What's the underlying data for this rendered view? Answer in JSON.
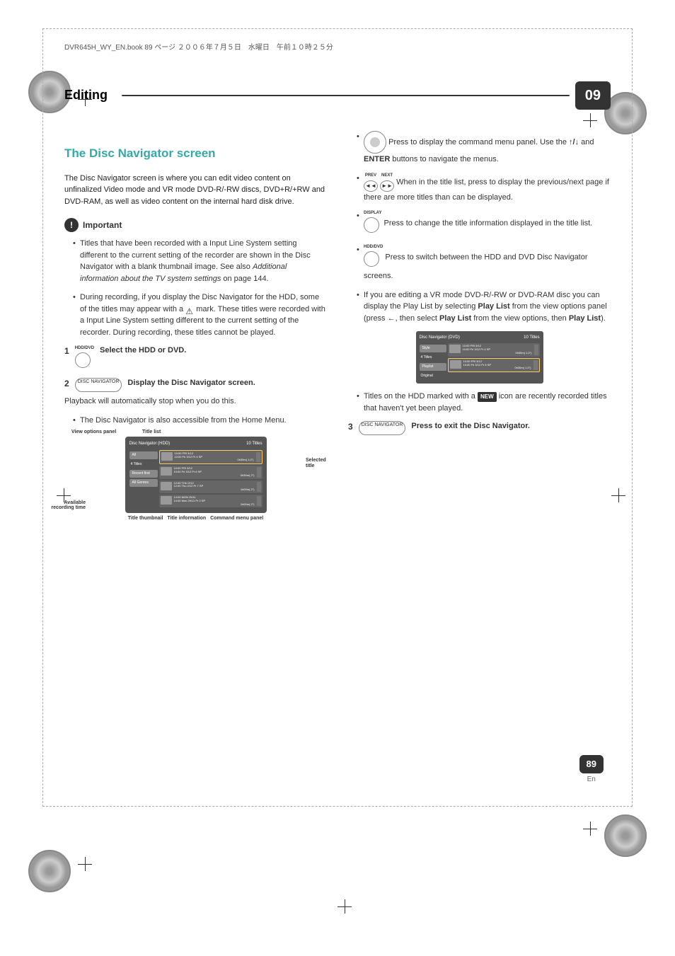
{
  "header_note": "DVR645H_WY_EN.book 89 ページ ２００６年７月５日　水曜日　午前１０時２５分",
  "chapter": {
    "title": "Editing",
    "number": "09"
  },
  "section_title": "The Disc Navigator screen",
  "intro": "The Disc Navigator screen is where you can edit video content on unfinalized Video mode and VR mode DVD-R/-RW discs, DVD+R/+RW and DVD-RAM, as well as video content on the internal hard disk drive.",
  "important_label": "Important",
  "important_bullets": [
    {
      "pre": "Titles that have been recorded with a Input Line System setting different to the current setting of the recorder are shown in the Disc Navigator with a blank thumbnail image. See also ",
      "italic": "Additional information about the TV system settings",
      "post": " on page 144."
    },
    {
      "pre": "During recording, if you display the Disc Navigator for the HDD, some of the titles may appear with a ",
      "mid": " mark. These titles were recorded with a Input Line System setting different to the current setting of the recorder. During recording, these titles cannot be played."
    }
  ],
  "steps": {
    "1": {
      "btn_label": "HDD/DVD",
      "text": "Select the HDD or DVD."
    },
    "2": {
      "btn_label": "DISC NAVIGATOR",
      "text": "Display the Disc Navigator screen.",
      "sub": "Playback will automatically stop when you do this.",
      "bullet": "The Disc Navigator is also accessible from the Home Menu."
    },
    "3": {
      "btn_label": "DISC NAVIGATOR",
      "text": "Press to exit the Disc Navigator."
    }
  },
  "diagram_labels": {
    "view_options": "View options panel",
    "title_list": "Title list",
    "selected_title": "Selected title",
    "available_time": "Available recording time",
    "title_thumb": "Title thumbnail",
    "title_info": "Title information",
    "cmd_panel": "Command menu panel"
  },
  "diag1": {
    "header": "Disc Navigator (HDD)",
    "titles_count": "10 Titles",
    "sidebar": [
      "All",
      "Recent first",
      "All Genres"
    ],
    "sidebar_count": "4 Titles",
    "rows": [
      {
        "line1": "10:00 FRI  3/12",
        "line2": "10:00  Fri 3/12 Pr 4 SP",
        "line3": "0h30m( 1,0\")"
      },
      {
        "line1": "10:00 FRI  3/12",
        "line2": "10:00  Fri 3/12 Pr 6 SP",
        "line3": "0h30m( 2\")"
      },
      {
        "line1": "12:00 THU  2/12",
        "line2": "12:00  Thu 2/12 Pr 7 SP",
        "line3": "1h00m( 2\")"
      },
      {
        "line1": "14:00 MON 29/11",
        "line2": "14:00  Mon 29/11 Pr 2 SP",
        "line3": "1h00m( 2\")"
      }
    ]
  },
  "diag2": {
    "header": "Disc Navigator (DVD)",
    "titles_count": "10 Titles",
    "sidebar": [
      "Style",
      "Original"
    ],
    "sidebar_body": [
      "Playlist"
    ],
    "sidebar_count": "4 Titles",
    "rows": [
      {
        "line1": "10:00 FRI  3/12",
        "line2": "10:00  Fri 3/12 Pr 4 SP",
        "line3": "0h30m( 1,0\")"
      },
      {
        "line1": "10:00 FRI  3/12",
        "line2": "10:00  Fri 3/12 Pr 6 SP",
        "line3": "0h30m( 1,0\")"
      }
    ]
  },
  "right_col": {
    "nav_dir": {
      "text": "Press to display the command menu panel. Use the ",
      "arrows": "↑/↓",
      "and": " and ",
      "enter": "ENTER",
      "text2": " buttons to navigate the menus."
    },
    "prev_next": {
      "prev_lbl": "PREV",
      "next_lbl": "NEXT",
      "prev_sym": "◄◄",
      "next_sym": "►►",
      "text": " When in the title list, press to display the previous/next page if there are more titles than can be displayed."
    },
    "display": {
      "label": "DISPLAY",
      "text": "Press to change the title information displayed in the title list."
    },
    "hdddvd": {
      "label": "HDD/DVD",
      "text": "Press to switch between the HDD and DVD Disc Navigator screens."
    },
    "vr_edit": {
      "pre": "If you are editing a VR mode DVD-R/-RW or DVD-RAM disc you can display the Play List by selecting ",
      "b1": "Play List",
      "mid1": " from the view options panel (press ",
      "arrow": "←",
      "mid2": ", then select ",
      "b2": "Play List",
      "mid3": " from the view options, then ",
      "b3": "Play List",
      "post": ")."
    },
    "new_titles": {
      "pre": "Titles on the HDD marked with a ",
      "badge": "NEW",
      "post": " icon are recently recorded titles that haven't yet been played."
    }
  },
  "footer": {
    "page": "89",
    "lang": "En"
  }
}
